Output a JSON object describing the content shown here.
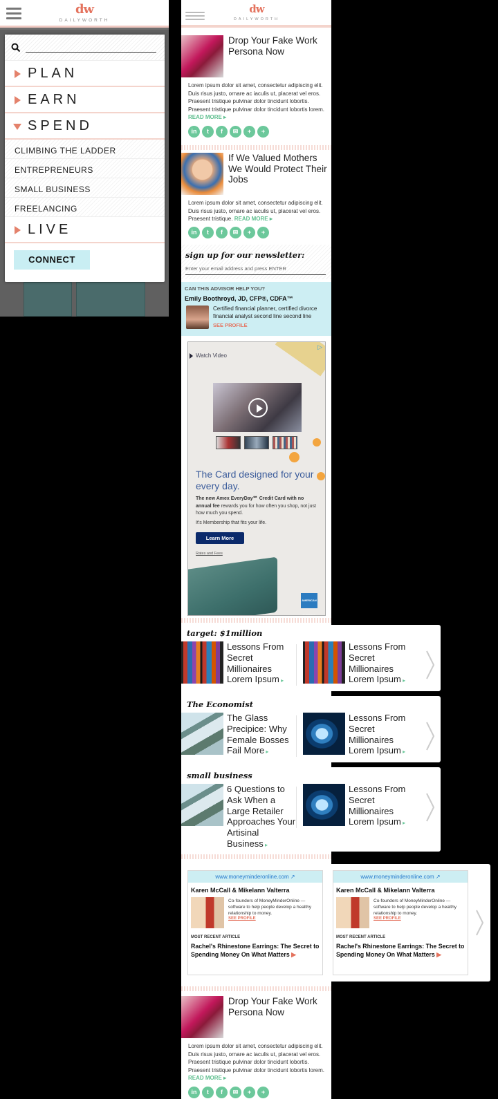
{
  "brand": {
    "logo": "dw",
    "wordmark": "DAILYWORTH"
  },
  "menu": {
    "items": [
      {
        "label": "PLAN"
      },
      {
        "label": "EARN"
      },
      {
        "label": "SPEND"
      }
    ],
    "subitems": [
      "CLIMBING THE LADDER",
      "ENTREPRENEURS",
      "SMALL BUSINESS",
      "FREELANCING"
    ],
    "live_label": "LIVE",
    "connect_label": "CONNECT"
  },
  "articles": [
    {
      "title": "Drop Your Fake Work Persona Now",
      "body": "Lorem ipsum dolor sit amet, consectetur adipiscing elit. Duis risus justo, ornare ac iaculis ut, placerat vel eros. Praesent tristique pulvinar dolor tincidunt lobortis. Praesent tristique pulvinar dolor tincidunt lobortis lorem.",
      "read_more": "READ MORE ▸"
    },
    {
      "title": "If We Valued Mothers We Would Protect Their Jobs",
      "body": "Lorem ipsum dolor sit amet, consectetur adipiscing elit. Duis risus justo, ornare ac iaculis ut, placerat vel eros. Praesent tristique.",
      "read_more": "READ MORE ▸"
    },
    {
      "title": "Drop Your Fake Work Persona Now",
      "body": "Lorem ipsum dolor sit amet, consectetur adipiscing elit. Duis risus justo, ornare ac iaculis ut, placerat vel eros. Praesent tristique pulvinar dolor tincidunt lobortis. Praesent tristique pulvinar dolor tincidunt lobortis lorem.",
      "read_more": "READ MORE ▸"
    }
  ],
  "social_icons": [
    "linkedin-icon",
    "twitter-icon",
    "facebook-icon",
    "email-icon",
    "plus-icon",
    "add-icon"
  ],
  "newsletter": {
    "title": "sign up for our newsletter:",
    "placeholder": "Enter your email address and press ENTER"
  },
  "advisor": {
    "question": "CAN THIS ADVISOR HELP YOU?",
    "name": "Emily Boothroyd, JD, CFP®, CDFA™",
    "description": "Certified financial planner, certified divorce financial analyst second line second line",
    "see_profile": "SEE PROFILE"
  },
  "ad": {
    "watch_video": "Watch Video",
    "headline": "The Card designed for your every day.",
    "copy_bold": "The new Amex EveryDay℠ Credit Card with no annual fee",
    "copy_rest": " rewards you for how often you shop, not just how much you spend.",
    "tagline": "It's Membership that fits your life.",
    "button": "Learn More",
    "rates": "Rates and Fees",
    "amex": "AMERICAN EXPRESS"
  },
  "sections": [
    {
      "header": "target: $1million",
      "items": [
        {
          "title": "Lessons From Secret Millionaires Lorem Ipsum",
          "image": "soda"
        },
        {
          "title": "Lessons From Secret Millionaires Lorem Ipsum",
          "image": "soda"
        }
      ]
    },
    {
      "header": "The Economist",
      "items": [
        {
          "title": "The Glass Precipice: Why Female Bosses Fail More",
          "image": "glass"
        },
        {
          "title": "Lessons From Secret Millionaires Lorem Ipsum",
          "image": "brain"
        }
      ]
    },
    {
      "header": "small business",
      "items": [
        {
          "title": "6 Questions to Ask When a Large Retailer Approaches Your Artisinal Business",
          "image": "glass"
        },
        {
          "title": "Lessons From Secret Millionaires Lorem Ipsum",
          "image": "brain"
        }
      ]
    }
  ],
  "partners": [
    {
      "url": "www.moneyminderonline.com",
      "names": "Karen McCall & Mikelann Valterra",
      "description": "Co-founders of MoneyMinderOnline — software to help people develop a healthy relationship to money.",
      "see_profile": "SEE PROFILE",
      "recent_label": "MOST RECENT ARTICLE",
      "recent_title": "Rachel's Rhinestone Earrings: The Secret to Spending Money On What Matters"
    },
    {
      "url": "www.moneyminderonline.com",
      "names": "Karen McCall & Mikelann Valterra",
      "description": "Co-founders of MoneyMinderOnline — software to help people develop a healthy relationship to money.",
      "see_profile": "SEE PROFILE",
      "recent_label": "MOST RECENT ARTICLE",
      "recent_title": "Rachel's Rhinestone Earrings: The Secret to Spending Money On What Matters"
    }
  ],
  "colors": {
    "accent": "#e4735e",
    "green": "#6cc89b",
    "cyan": "#cdeef3"
  }
}
